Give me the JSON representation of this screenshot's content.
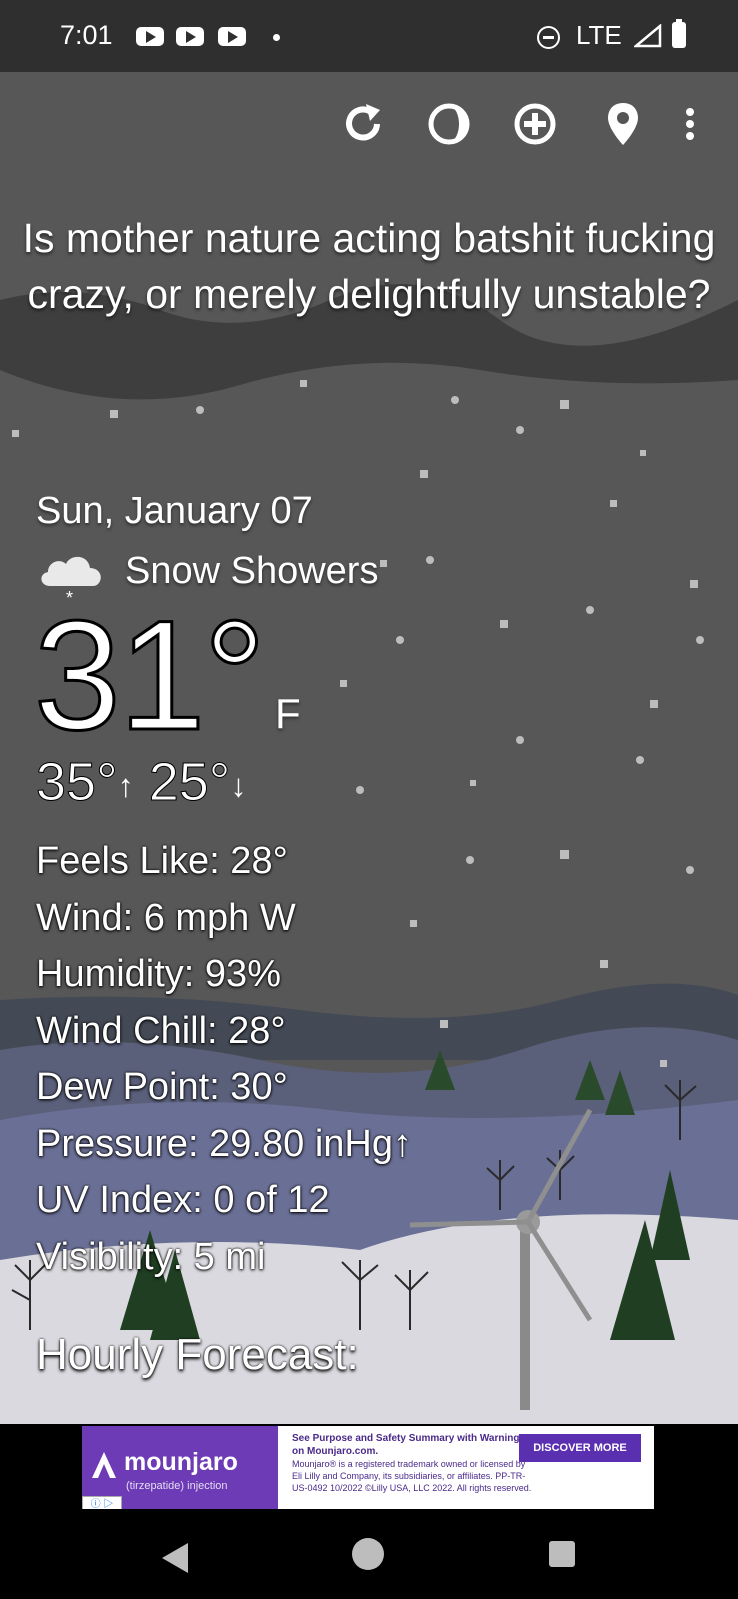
{
  "status_bar": {
    "time": "7:01",
    "network": "LTE"
  },
  "toolbar": {
    "icons": [
      "refresh-icon",
      "moon-phase-icon",
      "add-location-icon",
      "location-pin-icon",
      "more-options-icon"
    ]
  },
  "headline": "Is mother nature acting batshit fucking crazy, or merely delightfully unstable?",
  "weather": {
    "date": "Sun, January 07",
    "condition": "Snow Showers",
    "temperature": "31°",
    "unit": "F",
    "high": "35°",
    "low": "25°"
  },
  "details": [
    "Feels Like:  28°",
    "Wind:  6 mph W",
    "Humidity:  93%",
    "Wind Chill:  28°",
    "Dew Point:  30°",
    "Pressure:  29.80 inHg↑",
    "UV Index:  0 of 12",
    "Visibility:  5 mi"
  ],
  "hourly_heading": "Hourly Forecast:",
  "ad": {
    "brand": "mounjaro",
    "brand_sub": "(tirzepatide) injection",
    "headline": "See Purpose and Safety Summary with Warnings on Mounjaro.com.",
    "fineprint": "Mounjaro® is a registered trademark owned or licensed by Eli Lilly and Company, its subsidiaries, or affiliates. PP-TR-US-0492 10/2022 ©Lilly USA, LLC 2022. All rights reserved.",
    "cta": "DISCOVER MORE"
  }
}
